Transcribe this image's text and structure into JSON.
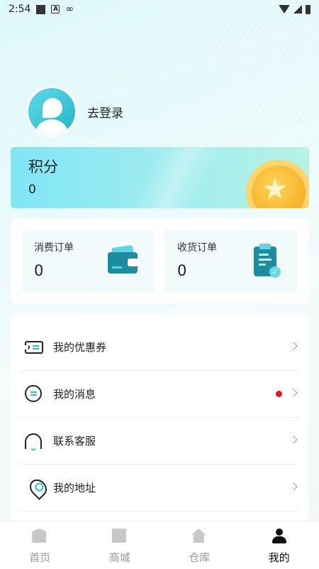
{
  "status_bar": {
    "time": "2:54",
    "a_label": "A",
    "infinity": "∞"
  },
  "profile": {
    "login_text": "去登录"
  },
  "points": {
    "title": "积分",
    "value": "0"
  },
  "orders": [
    {
      "label": "消费订单",
      "count": "0",
      "icon": "wallet-icon"
    },
    {
      "label": "收货订单",
      "count": "0",
      "icon": "clipboard-icon"
    }
  ],
  "menu": [
    {
      "label": "我的优惠券",
      "icon": "coupon-icon",
      "has_badge": false
    },
    {
      "label": "我的消息",
      "icon": "message-icon",
      "has_badge": true
    },
    {
      "label": "联系客服",
      "icon": "headset-icon",
      "has_badge": false
    },
    {
      "label": "我的地址",
      "icon": "location-icon",
      "has_badge": false
    }
  ],
  "tabs": [
    {
      "label": "首页",
      "icon": "home-icon",
      "active": false
    },
    {
      "label": "商城",
      "icon": "shop-bag-icon",
      "active": false
    },
    {
      "label": "仓库",
      "icon": "warehouse-icon",
      "active": false
    },
    {
      "label": "我的",
      "icon": "user-icon",
      "active": true
    }
  ],
  "colors": {
    "accent": "#2bc3d3",
    "badge": "#ee1122",
    "icon_dark": "#1e8c9f"
  }
}
